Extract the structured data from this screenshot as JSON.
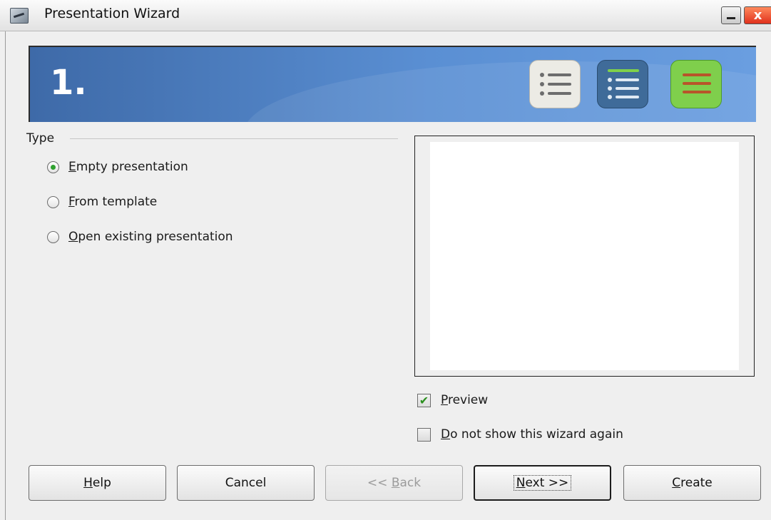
{
  "window": {
    "title": "Presentation Wizard",
    "close_glyph": "x",
    "app_icon": "impress-icon"
  },
  "banner": {
    "step_number": "1.",
    "background_color": "#5a8fd3",
    "icons": [
      "outline-list-icon",
      "bullet-list-icon",
      "notes-list-icon"
    ]
  },
  "type_group": {
    "label": "Type",
    "options": [
      {
        "mnemonic": "E",
        "rest": "mpty presentation",
        "selected": true
      },
      {
        "mnemonic": "F",
        "rest": "rom template",
        "selected": false
      },
      {
        "mnemonic": "O",
        "rest": "pen existing presentation",
        "selected": false
      }
    ]
  },
  "preview_checkbox": {
    "mnemonic": "P",
    "rest": "review",
    "checked": true,
    "check_glyph": "✔"
  },
  "dont_show_checkbox": {
    "mnemonic": "D",
    "rest": "o not show this wizard again",
    "checked": false
  },
  "buttons": {
    "help": {
      "mnemonic": "H",
      "rest": "elp"
    },
    "cancel": {
      "label": "Cancel"
    },
    "back": {
      "prefix": "<< ",
      "mnemonic": "B",
      "rest": "ack",
      "enabled": false
    },
    "next": {
      "mnemonic": "N",
      "rest": "ext >>",
      "default": true
    },
    "create": {
      "mnemonic": "C",
      "rest": "reate"
    }
  },
  "colors": {
    "radio_selected": "#2fa12f",
    "checkbox_check": "#2a8f1e"
  }
}
